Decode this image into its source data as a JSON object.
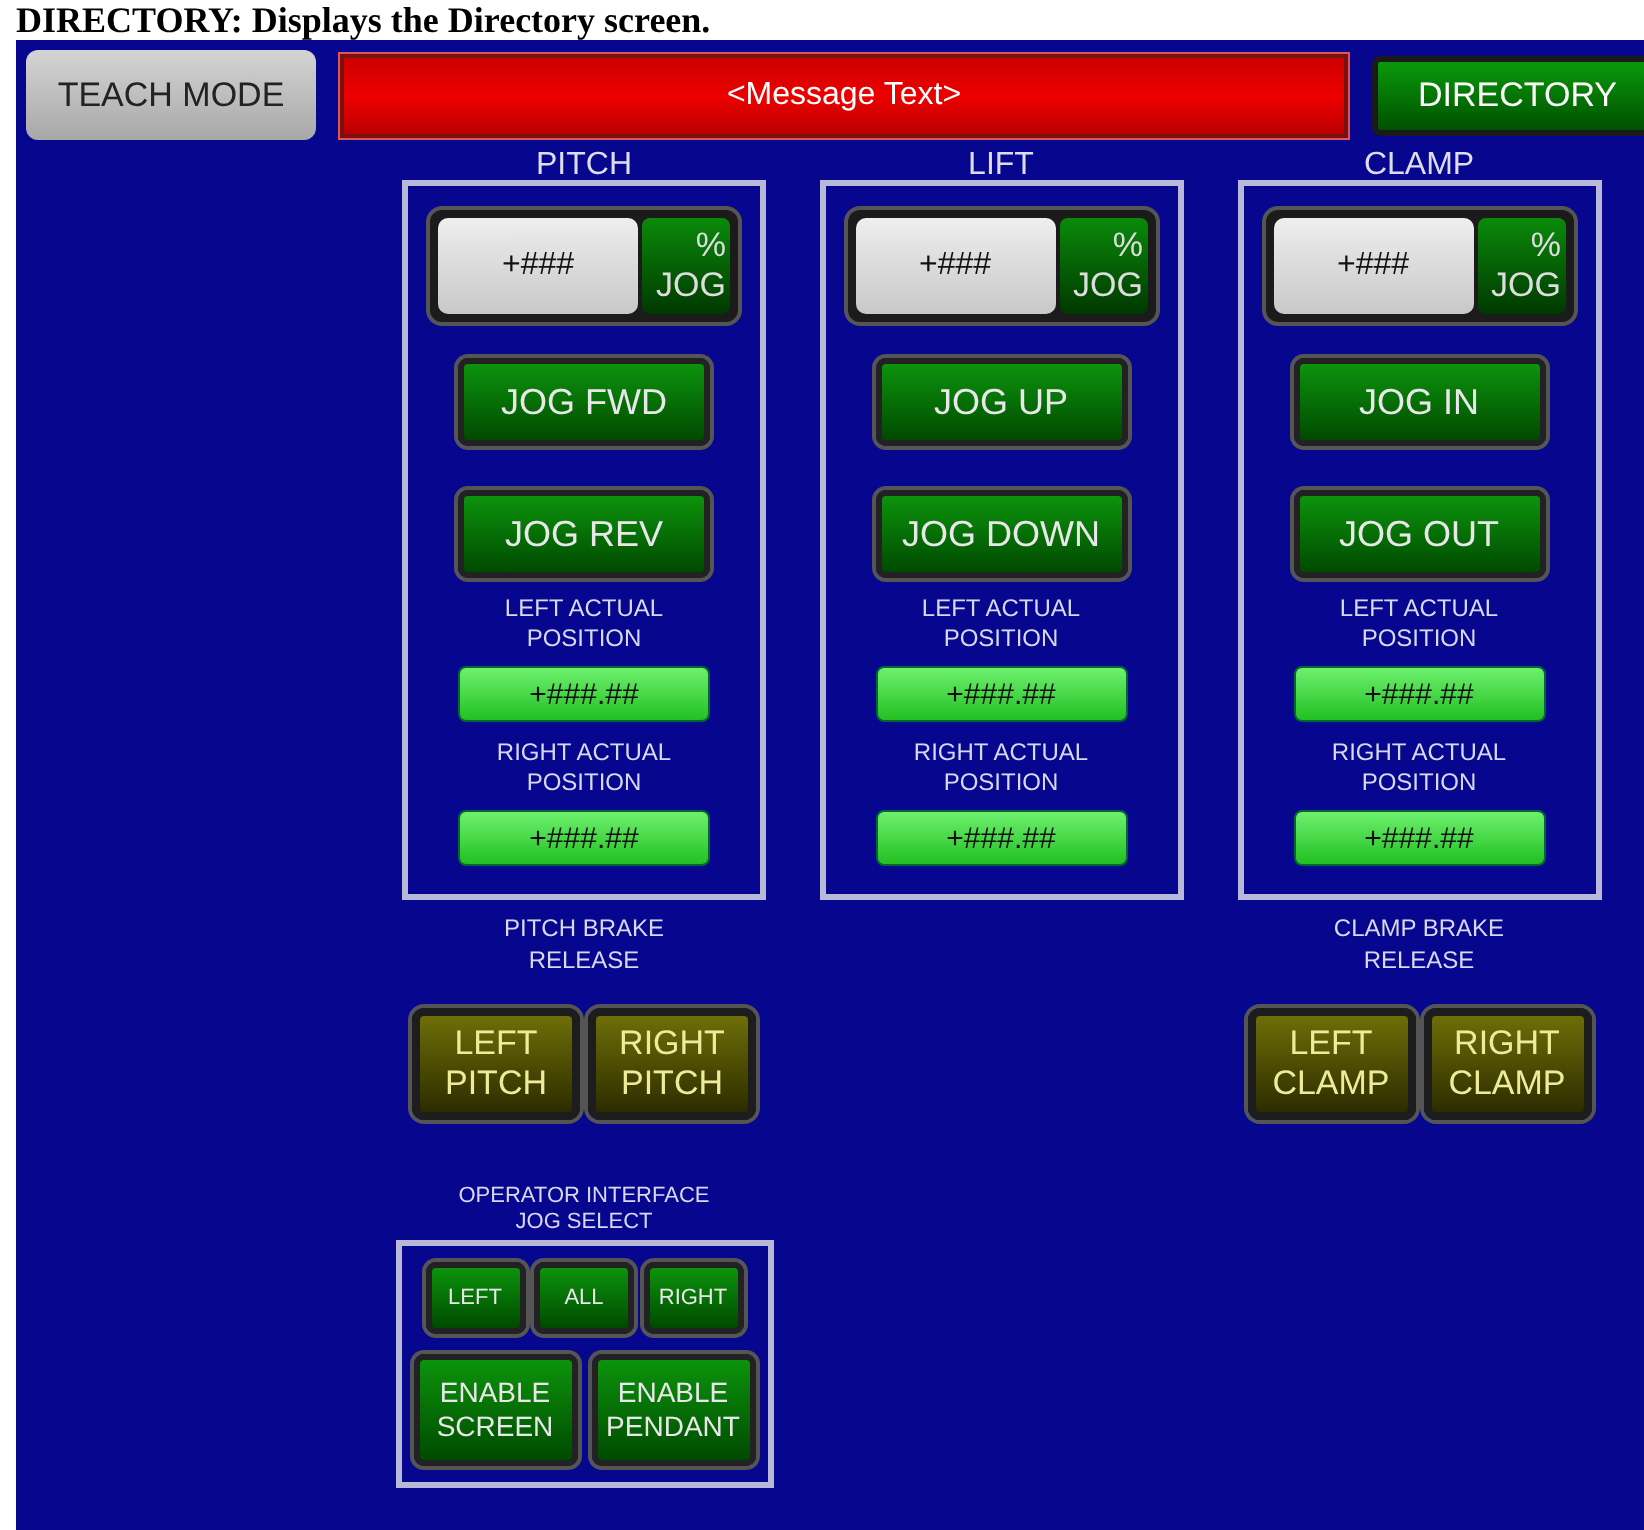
{
  "caption": "DIRECTORY: Displays the Directory screen.",
  "top_bar": {
    "mode_button": "TEACH MODE",
    "message": "<Message Text>",
    "directory_button": "DIRECTORY"
  },
  "axes": [
    {
      "title": "PITCH",
      "jog_value": "+###",
      "jog_button": "% JOG",
      "jog_buttons": [
        "JOG FWD",
        "JOG REV"
      ],
      "positions": [
        {
          "label": "LEFT ACTUAL POSITION",
          "value": "+###.##"
        },
        {
          "label": "RIGHT ACTUAL POSITION",
          "value": "+###.##"
        }
      ],
      "brake": {
        "label": "PITCH BRAKE RELEASE",
        "buttons": [
          "LEFT PITCH",
          "RIGHT PITCH"
        ]
      }
    },
    {
      "title": "LIFT",
      "jog_value": "+###",
      "jog_button": "% JOG",
      "jog_buttons": [
        "JOG UP",
        "JOG DOWN"
      ],
      "positions": [
        {
          "label": "LEFT ACTUAL POSITION",
          "value": "+###.##"
        },
        {
          "label": "RIGHT ACTUAL POSITION",
          "value": "+###.##"
        }
      ]
    },
    {
      "title": "CLAMP",
      "jog_value": "+###",
      "jog_button": "% JOG",
      "jog_buttons": [
        "JOG IN",
        "JOG OUT"
      ],
      "positions": [
        {
          "label": "LEFT ACTUAL POSITION",
          "value": "+###.##"
        },
        {
          "label": "RIGHT ACTUAL POSITION",
          "value": "+###.##"
        }
      ],
      "brake": {
        "label": "CLAMP BRAKE RELEASE",
        "buttons": [
          "LEFT CLAMP",
          "RIGHT CLAMP"
        ]
      }
    }
  ],
  "operator_interface": {
    "label": "OPERATOR INTERFACE JOG SELECT",
    "select_buttons": [
      "LEFT",
      "ALL",
      "RIGHT"
    ],
    "enable_buttons": [
      "ENABLE SCREEN",
      "ENABLE PENDANT"
    ]
  }
}
